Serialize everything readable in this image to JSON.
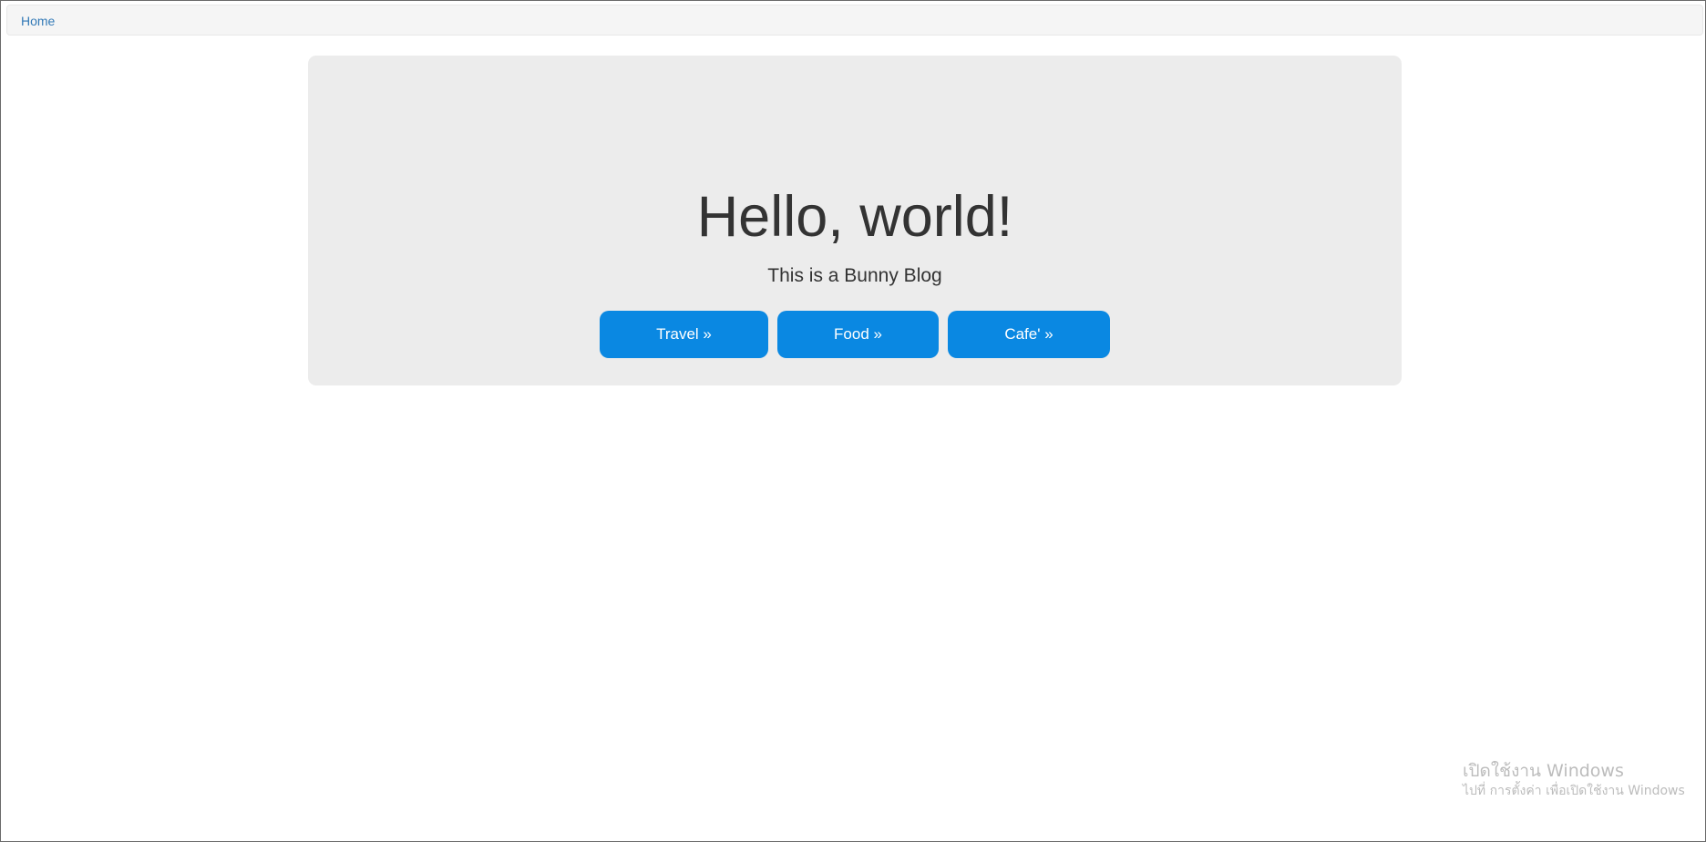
{
  "navbar": {
    "home_label": "Home"
  },
  "hero": {
    "title": "Hello, world!",
    "subtitle": "This is a Bunny Blog"
  },
  "buttons": [
    {
      "label": "Travel »"
    },
    {
      "label": "Food »"
    },
    {
      "label": "Cafe' »"
    }
  ],
  "watermark": {
    "line1": "เปิดใช้งาน Windows",
    "line2": "ไปที่ การตั้งค่า เพื่อเปิดใช้งาน Windows"
  },
  "colors": {
    "button_bg": "#0a88e2",
    "jumbotron_bg": "#ececec",
    "navbar_bg": "#f5f5f5",
    "link": "#337ab7"
  }
}
